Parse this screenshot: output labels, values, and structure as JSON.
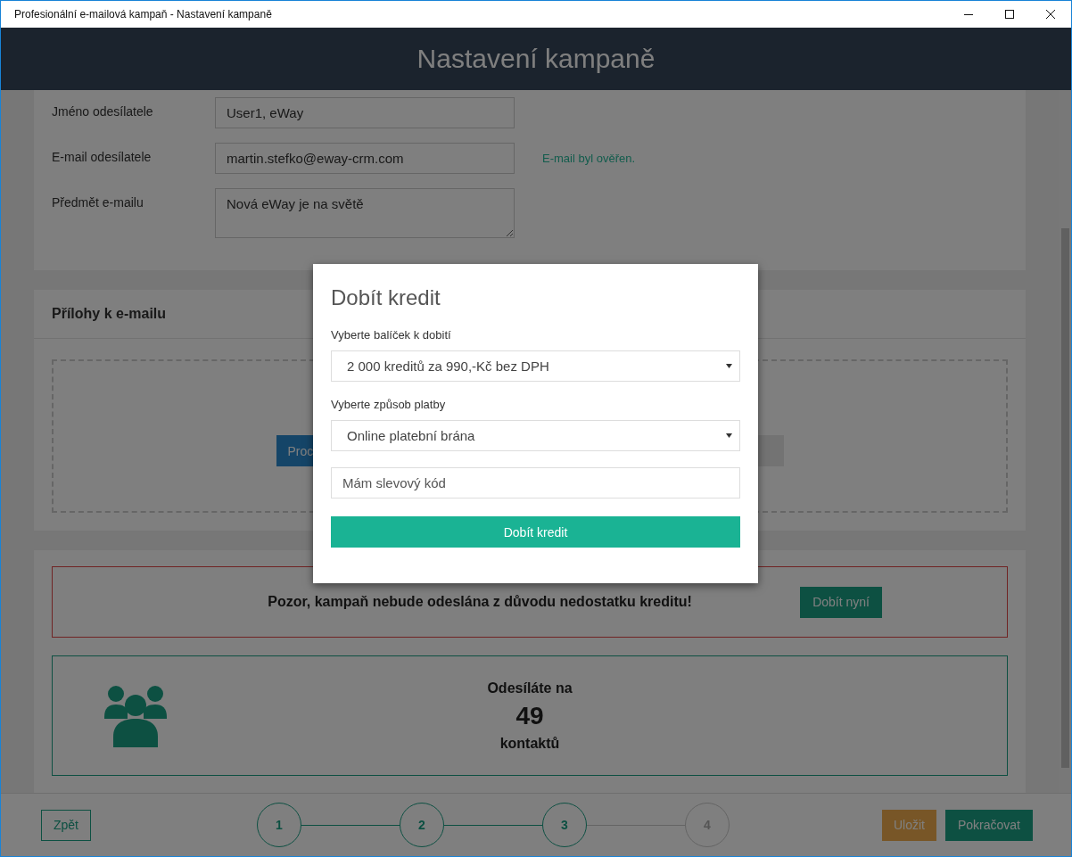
{
  "window": {
    "title": "Profesionální e-mailová kampaň - Nastavení kampaně"
  },
  "header": {
    "title": "Nastavení kampaně"
  },
  "sender_form": {
    "fields": [
      {
        "label": "Jméno odesílatele",
        "value": "User1, eWay",
        "kind": "input"
      },
      {
        "label": "E-mail odesílatele",
        "value": "martin.stefko@eway-crm.com",
        "kind": "input",
        "note": "E-mail byl ověřen."
      },
      {
        "label": "Předmět e-mailu",
        "value": "Nová eWay je na světě",
        "kind": "textarea"
      }
    ]
  },
  "attachments": {
    "title": "Přílohy k e-mailu",
    "browse_button": "Proc"
  },
  "warning": {
    "text": "Pozor, kampaň nebude odeslána z důvodu nedostatku kreditu!",
    "button": "Dobít nyní"
  },
  "recipients": {
    "line1": "Odesíláte na",
    "count": "49",
    "line2": "kontaktů"
  },
  "footer": {
    "back": "Zpět",
    "steps": [
      {
        "label": "1",
        "done": true
      },
      {
        "label": "2",
        "done": true
      },
      {
        "label": "3",
        "done": true
      },
      {
        "label": "4",
        "done": false
      }
    ],
    "save": "Uložit",
    "next": "Pokračovat"
  },
  "dialog": {
    "title": "Dobít kredit",
    "package_label": "Vyberte balíček k dobití",
    "package": "2 000 kreditů za 990,-Kč bez DPH",
    "payment_label": "Vyberte způsob platby",
    "payment": "Online platební brána",
    "discount_placeholder": "Mám slevový kód",
    "submit": "Dobít kredit"
  }
}
